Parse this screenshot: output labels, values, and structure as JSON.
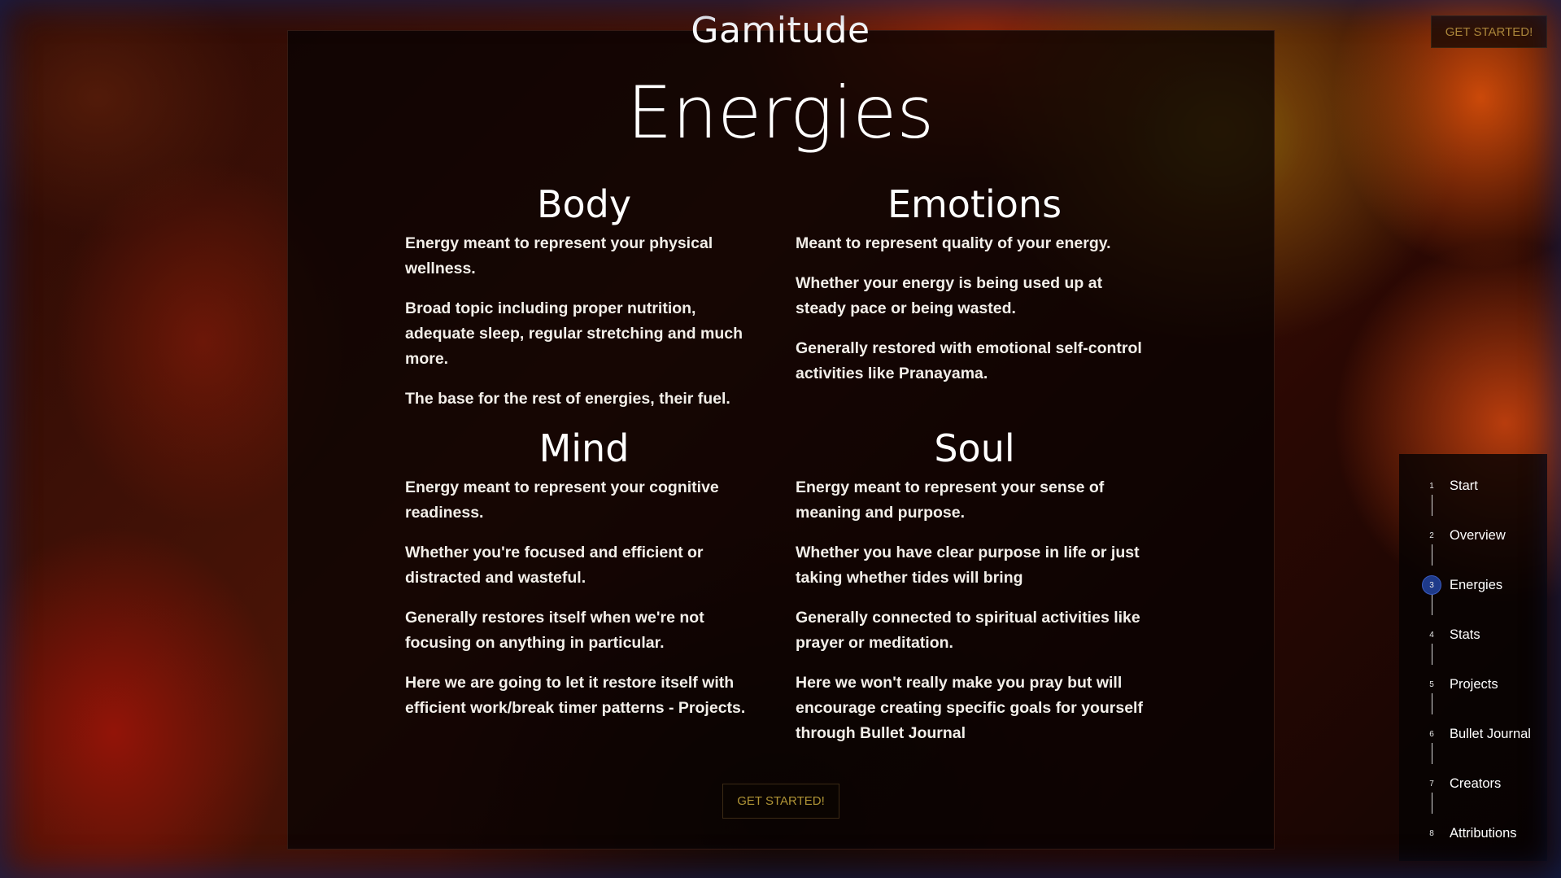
{
  "brand": "Gamitude",
  "title": "Energies",
  "header": {
    "cta_label": "GET STARTED!"
  },
  "sections": {
    "body": {
      "heading": "Body",
      "paragraphs": [
        "Energy meant to represent your physical wellness.",
        "Broad topic including proper nutrition, adequate sleep, regular stretching and much more.",
        "The base for the rest of energies, their fuel."
      ]
    },
    "emotions": {
      "heading": "Emotions",
      "paragraphs": [
        "Meant to represent quality of your energy.",
        "Whether your energy is being used up at steady pace or being wasted.",
        "Generally restored with emotional self-control activities like Pranayama."
      ]
    },
    "mind": {
      "heading": "Mind",
      "paragraphs": [
        "Energy meant to represent your cognitive readiness.",
        "Whether you're focused and efficient or distracted and wasteful.",
        "Generally restores itself when we're not focusing on anything in particular.",
        "Here we are going to let it restore itself with efficient work/break timer patterns - Projects."
      ]
    },
    "soul": {
      "heading": "Soul",
      "paragraphs": [
        "Energy meant to represent your sense of meaning and purpose.",
        "Whether you have clear purpose in life or just taking whether tides will bring",
        "Generally connected to spiritual activities like prayer or meditation.",
        "Here we won't really make you pray but will encourage creating specific goals for yourself through Bullet Journal"
      ]
    }
  },
  "cta_label": "GET STARTED!",
  "nav": {
    "active_index": 3,
    "items": [
      {
        "num": "1",
        "label": "Start"
      },
      {
        "num": "2",
        "label": "Overview"
      },
      {
        "num": "3",
        "label": "Energies"
      },
      {
        "num": "4",
        "label": "Stats"
      },
      {
        "num": "5",
        "label": "Projects"
      },
      {
        "num": "6",
        "label": "Bullet Journal"
      },
      {
        "num": "7",
        "label": "Creators"
      },
      {
        "num": "8",
        "label": "Attributions"
      }
    ]
  },
  "colors": {
    "accent_gold": "#b09436",
    "active_nav": "#1e3a8a"
  }
}
